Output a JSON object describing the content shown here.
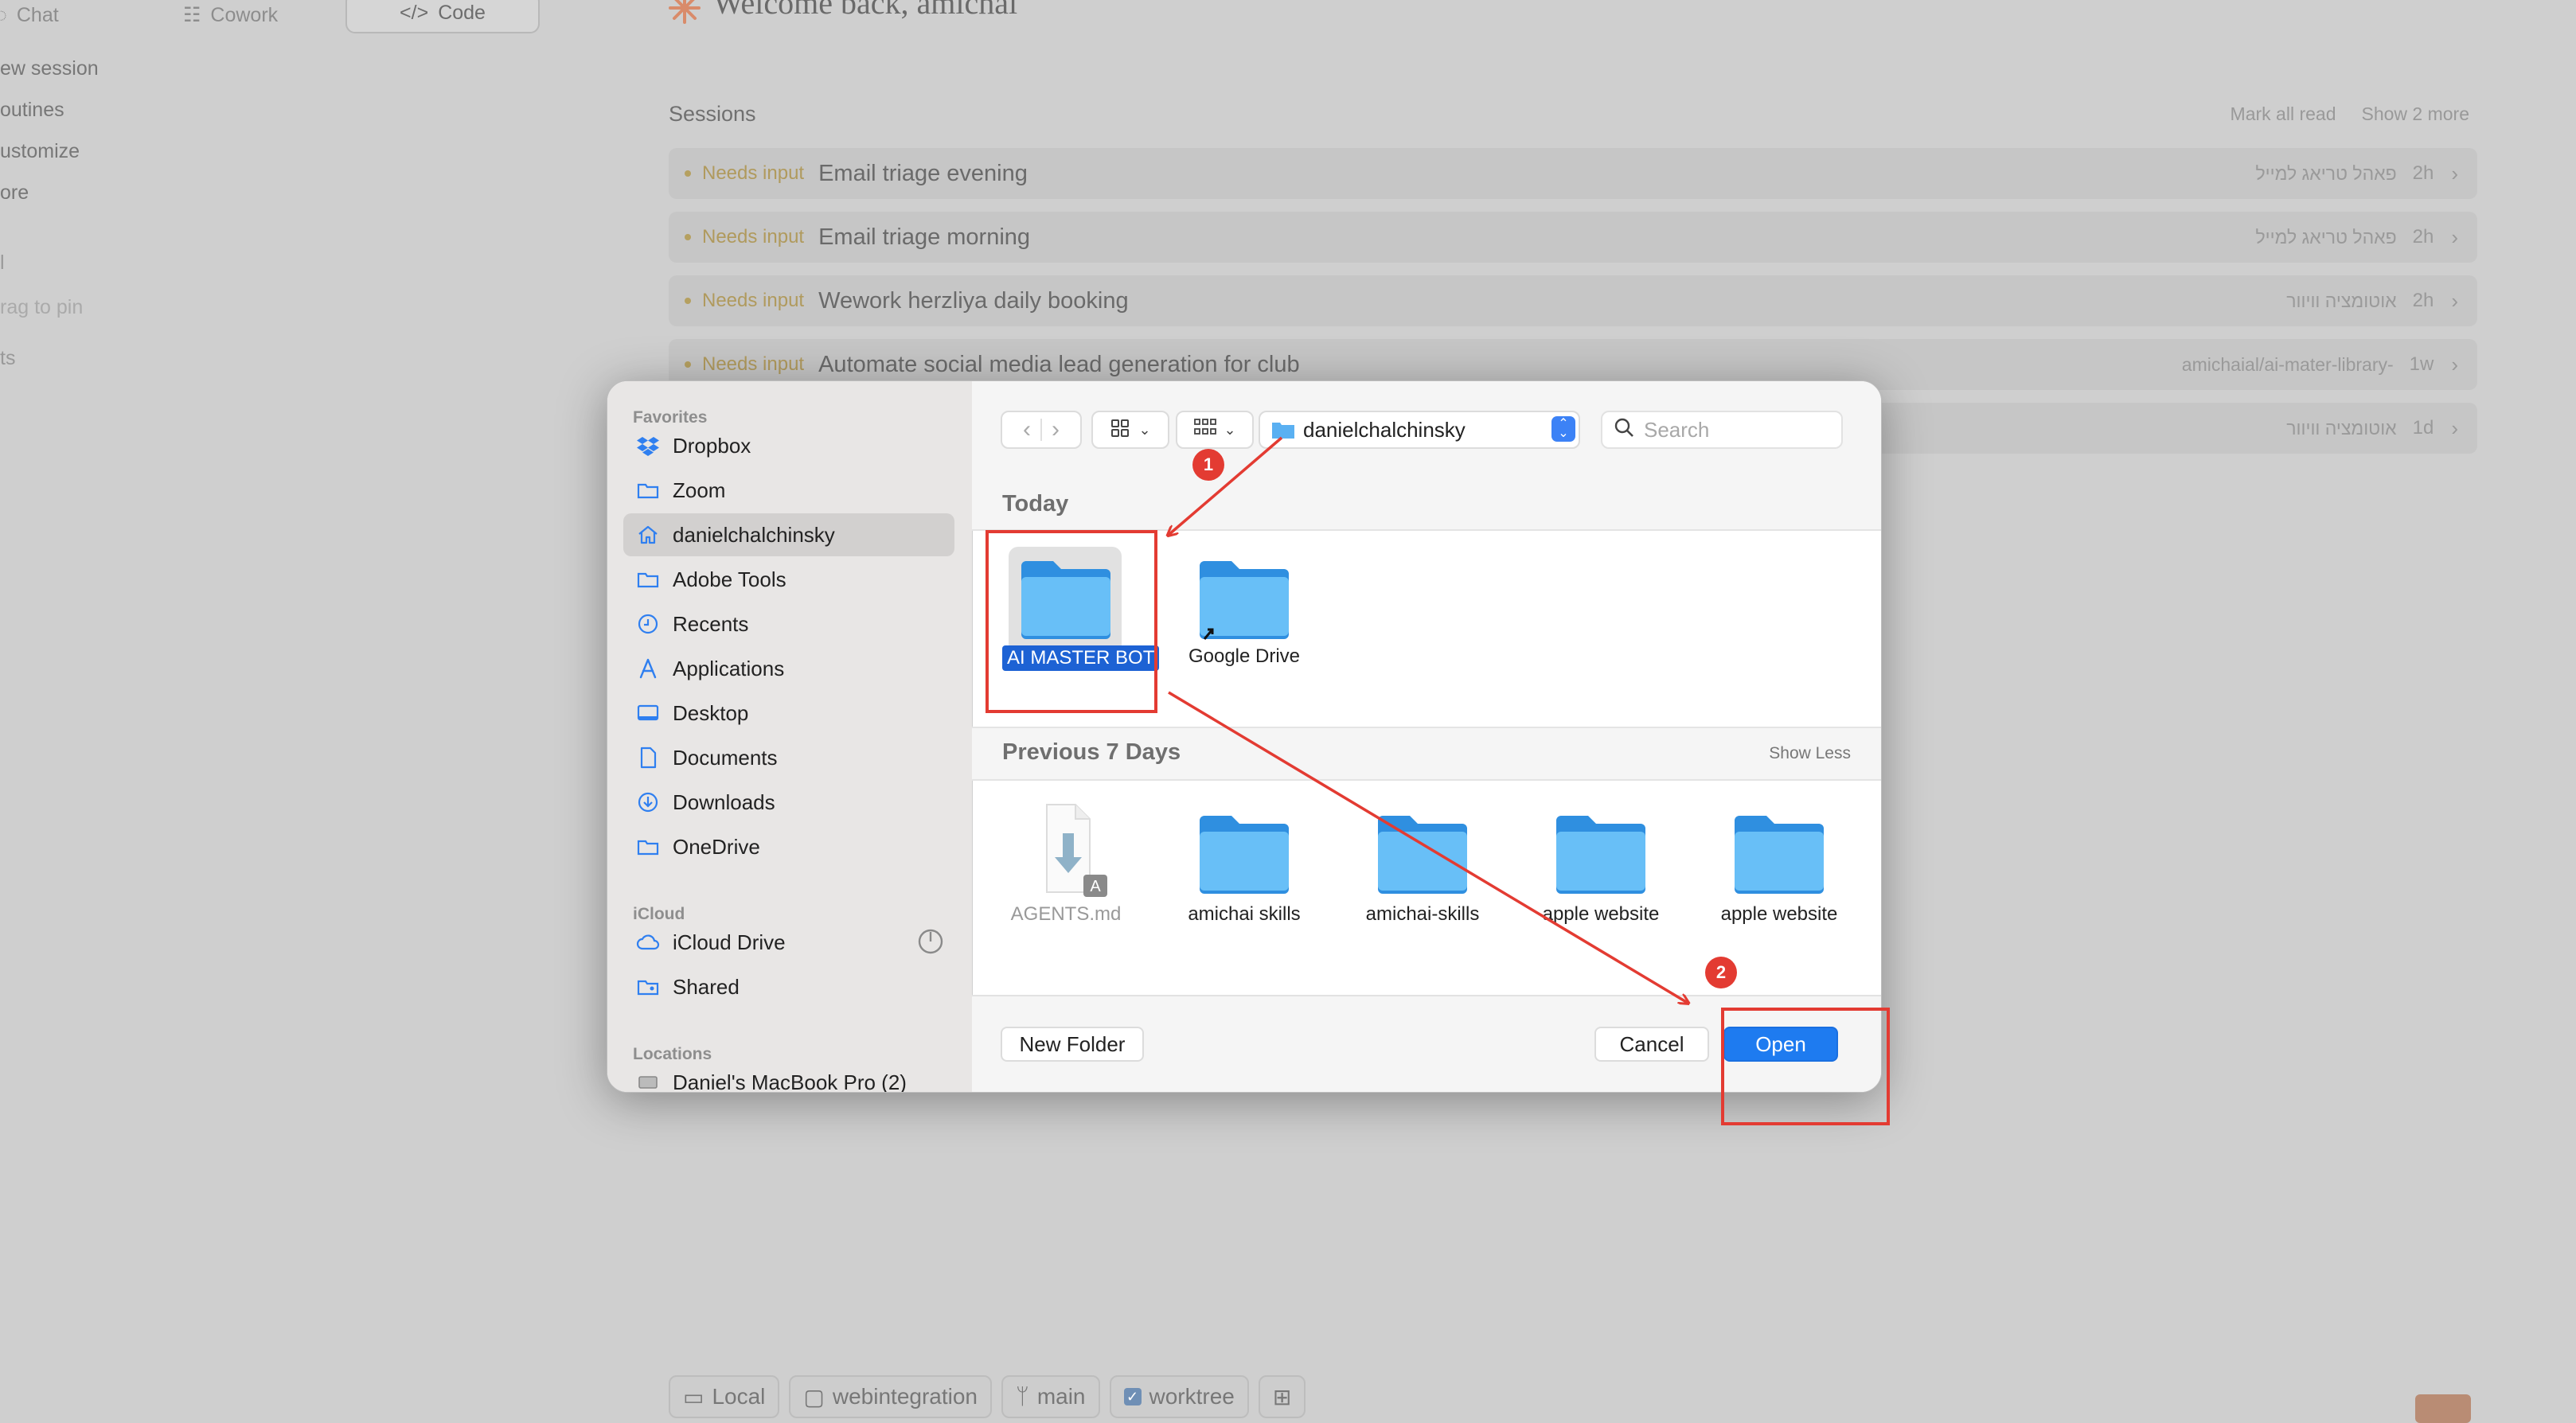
{
  "app": {
    "tabs": [
      {
        "label": "Chat"
      },
      {
        "label": "Cowork"
      },
      {
        "label": "Code"
      }
    ],
    "sidebar": [
      "ew session",
      "outines",
      "ustomize",
      "ore",
      "l",
      "rag to pin",
      "ts"
    ],
    "welcome": "Welcome back, amichai",
    "sessions": {
      "title": "Sessions",
      "mark_all_read": "Mark all read",
      "show_more": "Show 2 more",
      "rows": [
        {
          "tag": "Needs input",
          "title": "Email triage evening",
          "meta": "פאהל טריאג למייל",
          "age": "2h"
        },
        {
          "tag": "Needs input",
          "title": "Email triage morning",
          "meta": "פאהל טריאג למייל",
          "age": "2h"
        },
        {
          "tag": "Needs input",
          "title": "Wework herzliya daily booking",
          "meta": "אוטומציה וויוור",
          "age": "2h"
        },
        {
          "tag": "Needs input",
          "title": "Automate social media lead generation for club",
          "meta": "amichaial/ai-mater-library-",
          "age": "1w"
        },
        {
          "tag": "",
          "title": "",
          "meta": "אוטומציה וויוור",
          "age": "1d"
        }
      ]
    },
    "bottombar": {
      "local": "Local",
      "repo": "webintegration",
      "branch": "main",
      "worktree": "worktree"
    }
  },
  "dialog": {
    "sidebar": {
      "favorites_head": "Favorites",
      "favorites": [
        {
          "label": "Dropbox",
          "icon": "dropbox-icon"
        },
        {
          "label": "Zoom",
          "icon": "folder-icon"
        },
        {
          "label": "danielchalchinsky",
          "icon": "home-icon",
          "selected": true
        },
        {
          "label": "Adobe Tools",
          "icon": "folder-icon"
        },
        {
          "label": "Recents",
          "icon": "clock-icon"
        },
        {
          "label": "Applications",
          "icon": "applications-icon"
        },
        {
          "label": "Desktop",
          "icon": "desktop-icon"
        },
        {
          "label": "Documents",
          "icon": "document-icon"
        },
        {
          "label": "Downloads",
          "icon": "download-icon"
        },
        {
          "label": "OneDrive",
          "icon": "folder-icon"
        }
      ],
      "icloud_head": "iCloud",
      "icloud": [
        {
          "label": "iCloud Drive",
          "icon": "cloud-icon"
        },
        {
          "label": "Shared",
          "icon": "shared-folder-icon"
        }
      ],
      "locations_head": "Locations",
      "locations": [
        {
          "label": "Daniel's MacBook Pro (2)",
          "icon": "laptop-icon"
        }
      ]
    },
    "toolbar": {
      "path": "danielchalchinsky",
      "search_placeholder": "Search"
    },
    "today": {
      "title": "Today",
      "items": [
        {
          "label": "AI MASTER BOT",
          "selected": true
        },
        {
          "label": "Google Drive",
          "alias": true
        }
      ]
    },
    "previous": {
      "title": "Previous 7 Days",
      "show_less": "Show Less",
      "items": [
        {
          "label": "AGENTS.md",
          "type": "file"
        },
        {
          "label": "amichai skills",
          "type": "folder"
        },
        {
          "label": "amichai-skills",
          "type": "folder"
        },
        {
          "label": "apple website",
          "type": "folder"
        },
        {
          "label": "apple website",
          "type": "folder"
        }
      ]
    },
    "footer": {
      "new_folder": "New Folder",
      "cancel": "Cancel",
      "open": "Open"
    }
  },
  "annotations": {
    "badge1": "1",
    "badge2": "2",
    "color": "#e33b32"
  }
}
